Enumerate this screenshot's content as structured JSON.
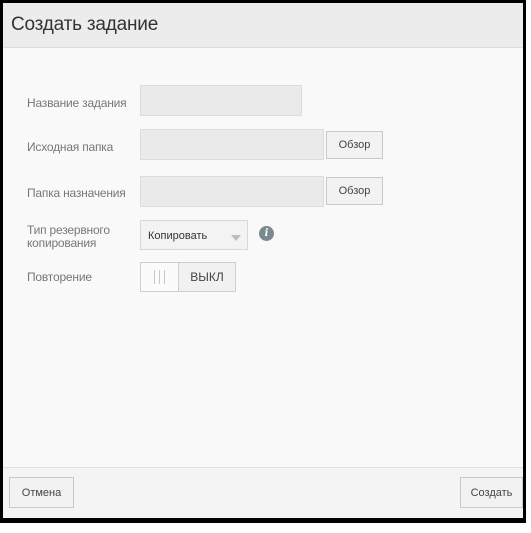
{
  "dialog": {
    "title": "Создать задание"
  },
  "form": {
    "job_name_label": "Название задания",
    "job_name_value": "",
    "source_label": "Исходная папка",
    "source_value": "",
    "source_browse": "Обзор",
    "dest_label": "Папка назначения",
    "dest_value": "",
    "dest_browse": "Обзор",
    "backup_type_label_line1": "Тип резервного",
    "backup_type_label_line2": "копирования",
    "backup_type_value": "Копировать",
    "repeat_label": "Повторение",
    "repeat_state": "ВЫКЛ"
  },
  "footer": {
    "cancel_label": "Отмена",
    "create_label": "Создать"
  },
  "icons": {
    "info": "info-icon",
    "dropdown": "chevron-down-icon"
  }
}
